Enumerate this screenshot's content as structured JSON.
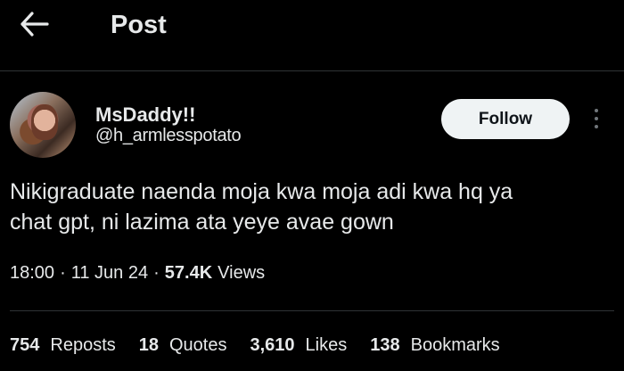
{
  "header": {
    "title": "Post"
  },
  "author": {
    "display_name": "MsDaddy!!",
    "handle": "@h_armlesspotato",
    "follow_label": "Follow"
  },
  "post": {
    "text_line1": "Nikigraduate naenda moja kwa moja adi kwa hq ya",
    "text_line2": "chat gpt, ni lazima ata yeye avae gown",
    "time": "18:00",
    "date": "11 Jun 24",
    "separator": "·",
    "views_count": "57.4K",
    "views_label": "Views"
  },
  "stats": [
    {
      "count": "754",
      "label": "Reposts"
    },
    {
      "count": "18",
      "label": "Quotes"
    },
    {
      "count": "3,610",
      "label": "Likes"
    },
    {
      "count": "138",
      "label": "Bookmarks"
    }
  ],
  "colors": {
    "background": "#000000",
    "text": "#e7e9ea",
    "secondary": "#71767b",
    "divider": "#2f3336",
    "follow_bg": "#eff3f4"
  }
}
